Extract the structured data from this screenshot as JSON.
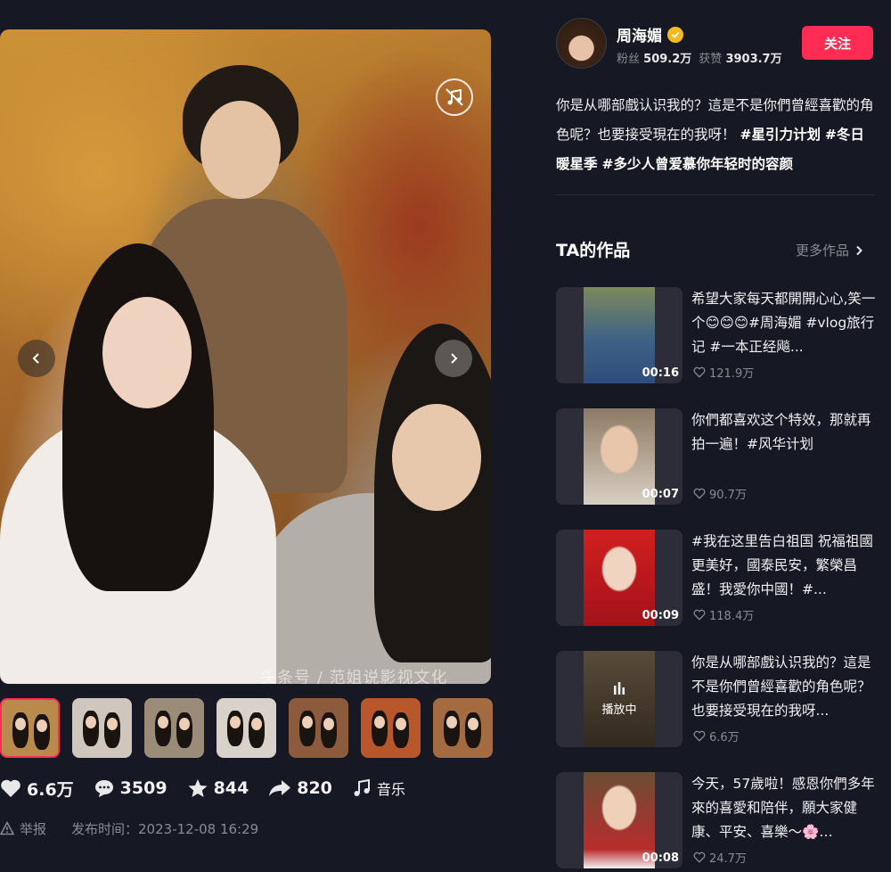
{
  "viewer": {
    "watermark": "头条号 / 范姐说影视文化",
    "thumbnail_count": 7,
    "active_thumbnail": 1
  },
  "stats": {
    "likes": "6.6万",
    "comments": "3509",
    "favorites": "844",
    "shares": "820",
    "music_label": "音乐"
  },
  "meta": {
    "report_label": "举报",
    "publish_time": "发布时间：2023-12-08 16:29"
  },
  "author": {
    "name": "周海媚",
    "fans_label": "粉丝",
    "fans": "509.2万",
    "likes_label": "获赞",
    "likes": "3903.7万",
    "follow_label": "关注"
  },
  "description": {
    "text": "你是从哪部戲认识我的？這是不是你們曾經喜歡的角色呢？也要接受現在的我呀！",
    "tags": [
      "#星引力计划",
      "#冬日暖星季",
      "#多少人曾爱慕你年轻时的容颜"
    ]
  },
  "works_section": {
    "title": "TA的作品",
    "more_label": "更多作品"
  },
  "works": [
    {
      "text": "希望大家每天都開開心心,笑一个😊😊😊#周海媚 #vlog旅行记 #一本正经飚...",
      "duration": "00:16",
      "likes": "121.9万",
      "playing": false
    },
    {
      "text": "你們都喜欢这个特效，那就再拍一遍！#风华计划",
      "duration": "00:07",
      "likes": "90.7万",
      "playing": false
    },
    {
      "text": "#我在这里告白祖国 祝福祖國更美好，國泰民安，繁榮昌盛！我愛你中國！#...",
      "duration": "00:09",
      "likes": "118.4万",
      "playing": false
    },
    {
      "text": "你是从哪部戲认识我的？這是不是你們曾經喜歡的角色呢？也要接受現在的我呀...",
      "duration": "",
      "likes": "6.6万",
      "playing": true,
      "playing_label": "播放中"
    },
    {
      "text": "今天，57歲啦！感恩你們多年來的喜愛和陪伴，願大家健康、平安、喜樂～🌸…",
      "duration": "00:08",
      "likes": "24.7万",
      "playing": false
    }
  ],
  "colors": {
    "background": "#161823",
    "accent": "#fe2c55",
    "verified": "#f5b922",
    "muted_text": "#8a8b91"
  }
}
